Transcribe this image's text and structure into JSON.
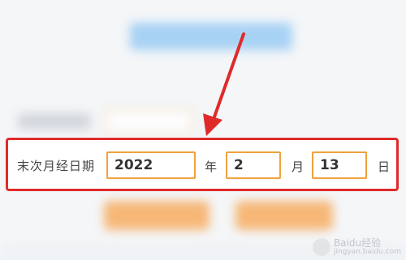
{
  "form": {
    "row_label": "末次月经日期",
    "year_value": "2022",
    "year_unit": "年",
    "month_value": "2",
    "month_unit": "月",
    "day_value": "13",
    "day_unit": "日"
  },
  "watermark": {
    "title": "Baidu经验",
    "url": "jingyan.baidu.com"
  },
  "colors": {
    "highlight": "#e02a2a",
    "input_border": "#f0a13c",
    "button": "#f7a34c",
    "header": "#8fc6f3"
  }
}
